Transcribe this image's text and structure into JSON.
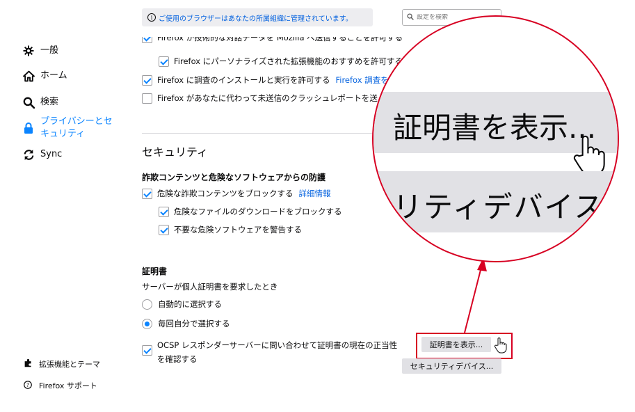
{
  "sidebar": {
    "items": [
      {
        "label": "一般",
        "icon": "gear-icon",
        "selected": false
      },
      {
        "label": "ホーム",
        "icon": "home-icon",
        "selected": false
      },
      {
        "label": "検索",
        "icon": "search-icon",
        "selected": false
      },
      {
        "label": "プライバシーとセ\nキュリティ",
        "icon": "lock-icon",
        "selected": true
      },
      {
        "label": "Sync",
        "icon": "sync-icon",
        "selected": false
      }
    ],
    "footer": [
      {
        "label": "拡張機能とテーマ",
        "icon": "puzzle-icon"
      },
      {
        "label": "Firefox サポート",
        "icon": "help-icon"
      }
    ]
  },
  "header": {
    "policy_notice": "ご使用のブラウザーはあなたの所属組織に管理されています。",
    "search_placeholder": "設定を検索"
  },
  "data_collection": {
    "items": [
      {
        "label": "Firefox が技術的な対話データを Mozilla へ送信することを許可する",
        "checked": true
      },
      {
        "label": "Firefox にパーソナライズされた拡張機能のおすすめを許可する",
        "checked": true
      },
      {
        "label": "Firefox に調査のインストールと実行を許可する",
        "link": "Firefox 調査を",
        "checked": true
      },
      {
        "label": "Firefox があなたに代わって未送信のクラッシュレポートを送",
        "checked": false
      }
    ]
  },
  "security": {
    "title": "セキュリティ",
    "phishing_heading": "詐欺コンテンツと危険なソフトウェアからの防護",
    "block_dangerous": "危険な詐欺コンテンツをブロックする",
    "learn_more": "詳細情報",
    "block_downloads": "危険なファイルのダウンロードをブロックする",
    "warn_software": "不要な危険ソフトウェアを警告する"
  },
  "certificates": {
    "heading": "証明書",
    "description": "サーバーが個人証明書を要求したとき",
    "auto_select": "自動的に選択する",
    "ask_every_time": "毎回自分で選択する",
    "ocsp_line1": "OCSP レスポンダーサーバーに問い合わせて証明書の現在の正当性",
    "ocsp_line2": "を確認する",
    "view_certificates": "証明書を表示...",
    "security_devices": "セキュリティデバイス..."
  },
  "magnifier": {
    "line1": "証明書を表示...",
    "line2": "リティデバイス"
  },
  "colors": {
    "accent": "#0a84ff",
    "link": "#0060df",
    "highlight": "#d70022"
  }
}
